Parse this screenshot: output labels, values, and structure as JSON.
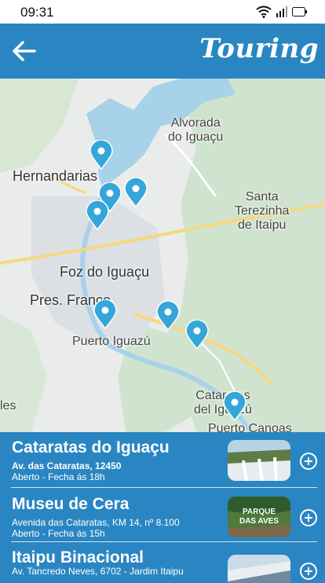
{
  "status": {
    "time": "09:31"
  },
  "header": {
    "title": "Touring"
  },
  "map": {
    "labels": {
      "alvorada": "Alvorada\ndo Iguaçu",
      "hernandarias": "Hernandarias",
      "santa": "Santa\nTerezinha\nde Itaipu",
      "foz": "Foz do Iguaçu",
      "pres": "Pres. Franco",
      "puerto_iguazu": "Puerto Iguazú",
      "cataratas": "Cataratas\ndel Iguazú",
      "puerto_canoas": "Puerto Canoas",
      "les": "les"
    }
  },
  "places": [
    {
      "name": "Cataratas do Iguaçu",
      "address": "Av. das Cataratas, 12450",
      "hours": "Aberto - Fecha ás 18h"
    },
    {
      "name": "Museu de Cera",
      "address": "Avenida das Cataratas, KM 14, nº 8.100",
      "hours": "Aberto - Fecha ás 15h",
      "thumb_text": "PARQUE DAS AVES"
    },
    {
      "name": "Itaipu Binacional",
      "address": "Av. Tancredo Neves, 6702 - Jardim Itaipu",
      "hours": ""
    }
  ]
}
